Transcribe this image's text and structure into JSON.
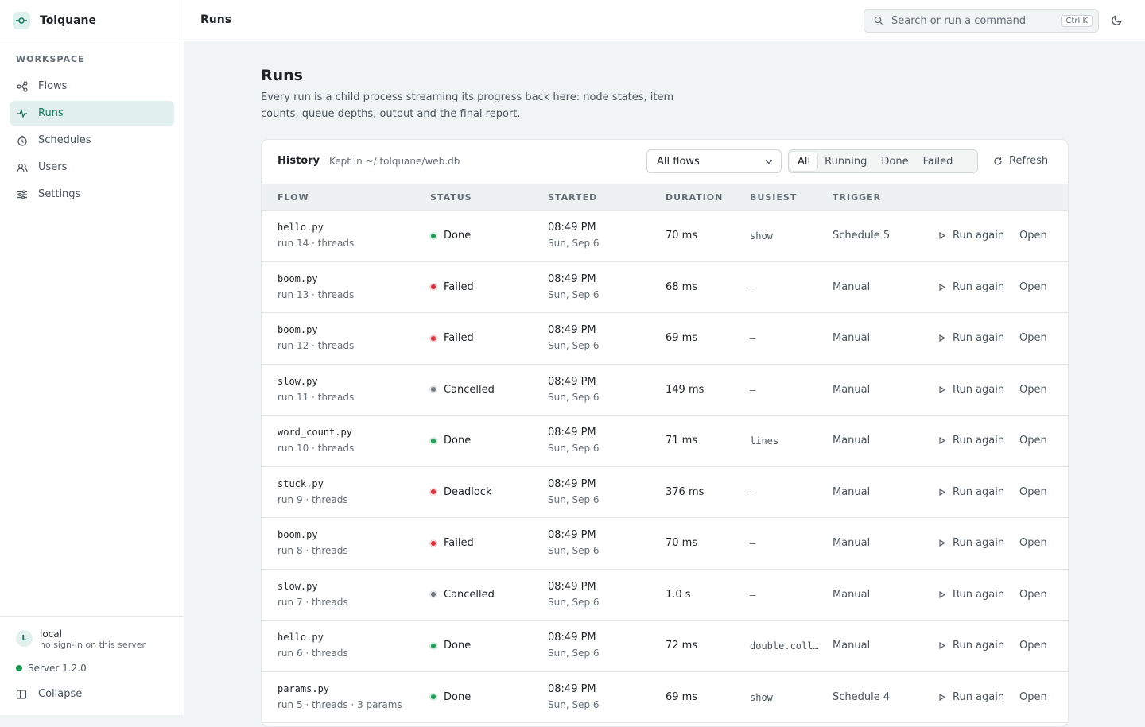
{
  "app": {
    "name": "Tolquane"
  },
  "sidebar": {
    "section_label": "WORKSPACE",
    "items": [
      {
        "label": "Flows",
        "icon": "flows-icon",
        "active": false
      },
      {
        "label": "Runs",
        "icon": "activity-icon",
        "active": true
      },
      {
        "label": "Schedules",
        "icon": "clock-icon",
        "active": false
      },
      {
        "label": "Users",
        "icon": "users-icon",
        "active": false
      },
      {
        "label": "Settings",
        "icon": "sliders-icon",
        "active": false
      }
    ],
    "user": {
      "initial": "L",
      "name": "local",
      "sub": "no sign-in on this server"
    },
    "server": "Server 1.2.0",
    "collapse": "Collapse"
  },
  "topbar": {
    "title": "Runs",
    "search_placeholder": "Search or run a command",
    "search_shortcut": "Ctrl K"
  },
  "page": {
    "title": "Runs",
    "description": "Every run is a child process streaming its progress back here: node states, item counts, queue depths, output and the final report."
  },
  "history": {
    "title": "History",
    "kept": "Kept in ~/.tolquane/web.db",
    "flow_filter": "All flows",
    "filters": [
      "All",
      "Running",
      "Done",
      "Failed"
    ],
    "active_filter": "All",
    "refresh": "Refresh"
  },
  "table": {
    "columns": [
      "FLOW",
      "STATUS",
      "STARTED",
      "DURATION",
      "BUSIEST",
      "TRIGGER"
    ],
    "action_run_again": "Run again",
    "action_open": "Open",
    "rows": [
      {
        "flow": "hello.py",
        "sub": "run 14 · threads",
        "status": "Done",
        "kind": "done",
        "time": "08:49 PM",
        "date": "Sun, Sep 6",
        "duration": "70 ms",
        "busiest": "show",
        "trigger": "Schedule 5"
      },
      {
        "flow": "boom.py",
        "sub": "run 13 · threads",
        "status": "Failed",
        "kind": "failed",
        "time": "08:49 PM",
        "date": "Sun, Sep 6",
        "duration": "68 ms",
        "busiest": "—",
        "trigger": "Manual"
      },
      {
        "flow": "boom.py",
        "sub": "run 12 · threads",
        "status": "Failed",
        "kind": "failed",
        "time": "08:49 PM",
        "date": "Sun, Sep 6",
        "duration": "69 ms",
        "busiest": "—",
        "trigger": "Manual"
      },
      {
        "flow": "slow.py",
        "sub": "run 11 · threads",
        "status": "Cancelled",
        "kind": "cancelled",
        "time": "08:49 PM",
        "date": "Sun, Sep 6",
        "duration": "149 ms",
        "busiest": "—",
        "trigger": "Manual"
      },
      {
        "flow": "word_count.py",
        "sub": "run 10 · threads",
        "status": "Done",
        "kind": "done",
        "time": "08:49 PM",
        "date": "Sun, Sep 6",
        "duration": "71 ms",
        "busiest": "lines",
        "trigger": "Manual"
      },
      {
        "flow": "stuck.py",
        "sub": "run 9 · threads",
        "status": "Deadlock",
        "kind": "failed",
        "time": "08:49 PM",
        "date": "Sun, Sep 6",
        "duration": "376 ms",
        "busiest": "—",
        "trigger": "Manual"
      },
      {
        "flow": "boom.py",
        "sub": "run 8 · threads",
        "status": "Failed",
        "kind": "failed",
        "time": "08:49 PM",
        "date": "Sun, Sep 6",
        "duration": "70 ms",
        "busiest": "—",
        "trigger": "Manual"
      },
      {
        "flow": "slow.py",
        "sub": "run 7 · threads",
        "status": "Cancelled",
        "kind": "cancelled",
        "time": "08:49 PM",
        "date": "Sun, Sep 6",
        "duration": "1.0 s",
        "busiest": "—",
        "trigger": "Manual"
      },
      {
        "flow": "hello.py",
        "sub": "run 6 · threads",
        "status": "Done",
        "kind": "done",
        "time": "08:49 PM",
        "date": "Sun, Sep 6",
        "duration": "72 ms",
        "busiest": "double.coll…",
        "trigger": "Manual"
      },
      {
        "flow": "params.py",
        "sub": "run 5 · threads · 3 params",
        "status": "Done",
        "kind": "done",
        "time": "08:49 PM",
        "date": "Sun, Sep 6",
        "duration": "69 ms",
        "busiest": "show",
        "trigger": "Schedule 4"
      }
    ]
  },
  "colors": {
    "accent": "#1b7a63",
    "done": "#1e9e55",
    "failed": "#d8313a",
    "cancelled": "#6c757d"
  }
}
